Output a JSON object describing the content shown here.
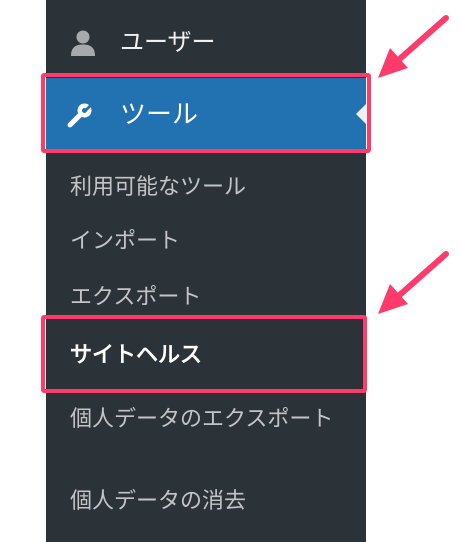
{
  "admin_menu": {
    "users_label": "ユーザー",
    "users_icon": "user-icon",
    "tools_label": "ツール",
    "tools_icon": "wrench-icon",
    "tools_current": true,
    "tools_submenu": [
      {
        "label": "利用可能なツール",
        "active": false
      },
      {
        "label": "インポート",
        "active": false
      },
      {
        "label": "エクスポート",
        "active": false
      },
      {
        "label": "サイトヘルス",
        "active": true
      },
      {
        "label": "個人データのエクスポート",
        "active": false
      },
      {
        "label": "個人データの消去",
        "active": false
      }
    ]
  },
  "annotations": {
    "highlight_color": "#ff3b6b",
    "arrow_color": "#ff3b6b",
    "highlighted": [
      "ツール",
      "サイトヘルス"
    ]
  },
  "colors": {
    "sidebar_bg": "#2c3338",
    "active_item_bg": "#2271b1",
    "submenu_text": "#c3c4c7",
    "active_text": "#ffffff"
  }
}
